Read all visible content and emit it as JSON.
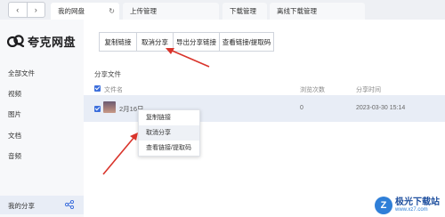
{
  "tabs": [
    {
      "label": "我的网盘"
    },
    {
      "label": "上传管理"
    },
    {
      "label": "下载管理"
    },
    {
      "label": "离线下载管理"
    }
  ],
  "nav": {
    "back": "‹",
    "forward": "›",
    "refresh": "↻"
  },
  "logo": {
    "text": "夸克网盘"
  },
  "sidebar": {
    "items": [
      {
        "label": "全部文件"
      },
      {
        "label": "视频"
      },
      {
        "label": "图片"
      },
      {
        "label": "文档"
      },
      {
        "label": "音频"
      },
      {
        "label": "我的分享"
      }
    ]
  },
  "toolbar": {
    "copy_link": "复制链接",
    "cancel_share": "取消分享",
    "export_links": "导出分享链接",
    "view_links": "查看链接/提取码"
  },
  "section_title": "分享文件",
  "table": {
    "headers": {
      "name": "文件名",
      "views": "浏览次数",
      "time": "分享时间"
    },
    "rows": [
      {
        "name": "2月16日",
        "views": "0",
        "time": "2023-03-30 15:14"
      }
    ]
  },
  "context_menu": {
    "items": [
      {
        "label": "复制链接"
      },
      {
        "label": "取消分享"
      },
      {
        "label": "查看链接/提取码"
      }
    ]
  },
  "watermark": {
    "badge": "Z",
    "title": "极光下载站",
    "url": "www.xz7.com"
  },
  "colors": {
    "accent": "#3d6fdc",
    "arrow": "#d9342b",
    "selected_bg": "#e8edf6"
  }
}
